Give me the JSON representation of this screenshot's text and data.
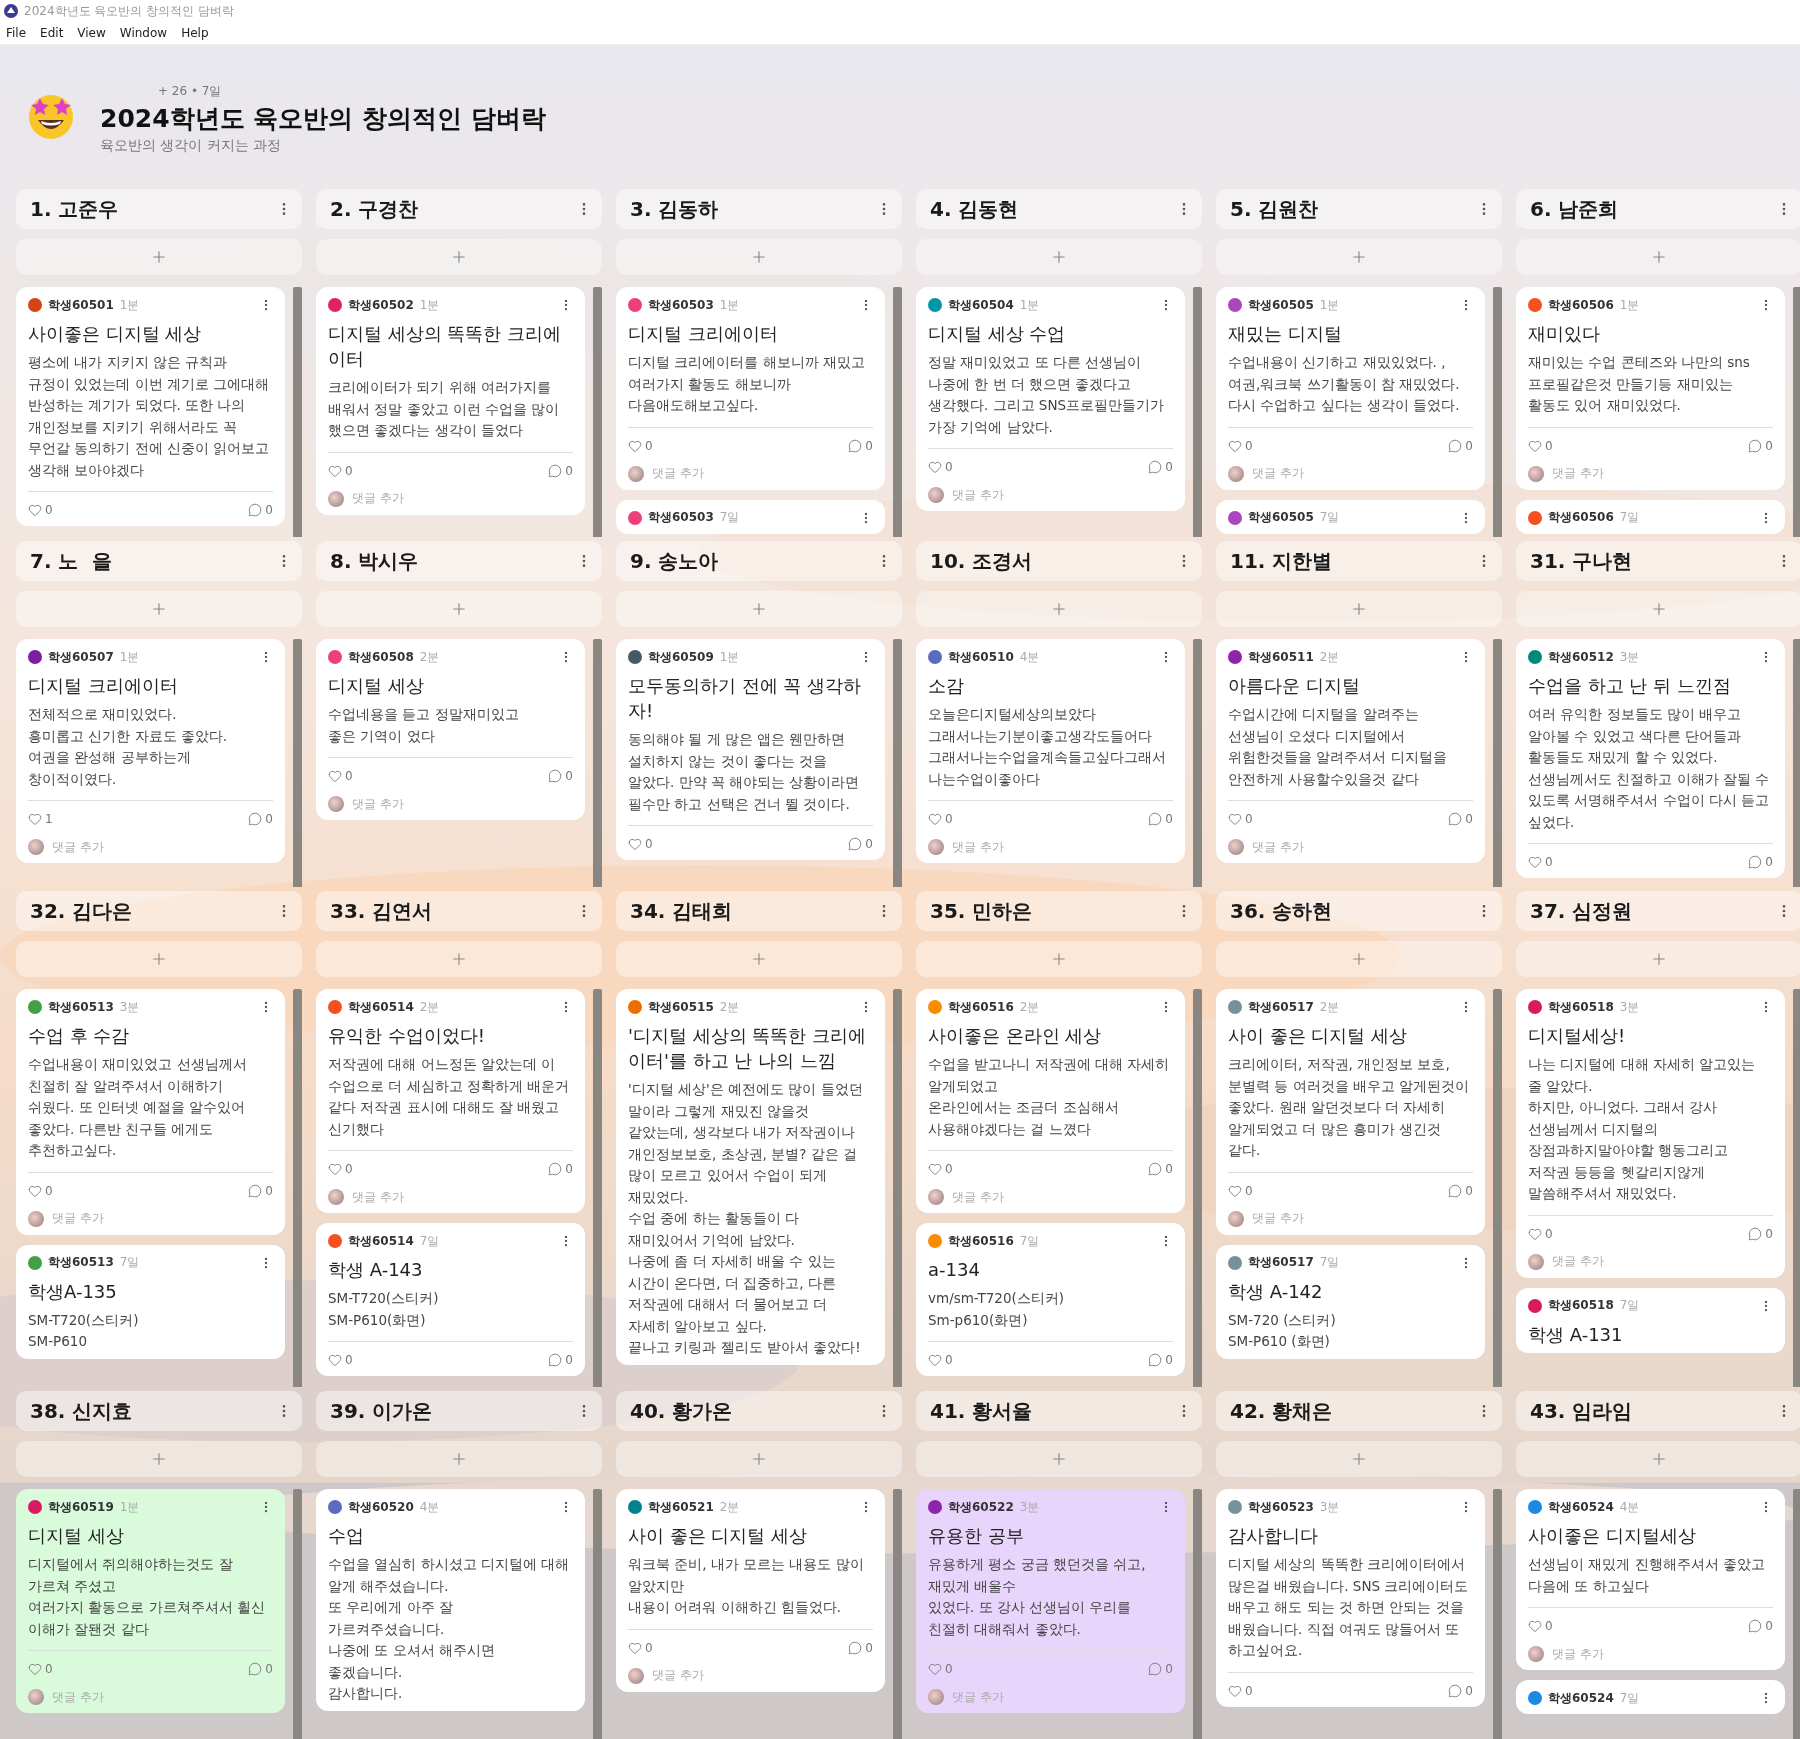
{
  "window": {
    "title": "2024학년도 육오반의 창의적인 담벼락"
  },
  "menu": [
    "File",
    "Edit",
    "View",
    "Window",
    "Help"
  ],
  "board": {
    "stats": "+ 26 • 7일",
    "title": "2024학년도 육오반의 창의적인 담벼락",
    "subtitle": "육오반의 생각이 커지는 과정"
  },
  "sections": [
    {
      "columns": [
        {
          "name": "1. 고준우",
          "posts": [
            {
              "author": "학생60501",
              "time": "1분",
              "color": "#d84315",
              "title": "사이좋은 디지털 세상",
              "body": "평소에 내가 지키지 않은 규칙과 규정이 있었는데 이번 계기로 그에대해 반성하는 계기가 되었다. 또한 나의 개인정보를 지키기 위해서라도 꼭 무언갈 동의하기 전에 신중이 읽어보고 생각해 보아야겠다",
              "likes": "0",
              "comments": "0"
            }
          ]
        },
        {
          "name": "2. 구경찬",
          "posts": [
            {
              "author": "학생60502",
              "time": "1분",
              "color": "#e0245e",
              "title": "디지털 세상의 똑똑한 크리에이터",
              "body": "크리에이터가 되기 위해 여러가지를 배워서 정말 좋았고 이런 수업을 많이 했으면 좋겠다는 생각이 들었다",
              "likes": "0",
              "comments": "0",
              "comment_placeholder": "댓글 추가"
            }
          ]
        },
        {
          "name": "3. 김동하",
          "posts": [
            {
              "author": "학생60503",
              "time": "1분",
              "color": "#ec407a",
              "title": "디지털 크리에이터",
              "body": "디지털 크리에이터를 해보니까 재밌고 여러가지 활동도 해보니까\n다음애도해보고싶다.",
              "likes": "0",
              "comments": "0",
              "comment_placeholder": "댓글 추가"
            },
            {
              "author": "학생60503",
              "time": "7일",
              "color": "#ec407a"
            }
          ]
        },
        {
          "name": "4. 김동현",
          "posts": [
            {
              "author": "학생60504",
              "time": "1분",
              "color": "#0097a7",
              "title": "디지털 세상 수업",
              "body": "정말 재미있었고 또 다른 선생님이 나중에 한 번 더 했으면 좋겠다고 생각했다. 그리고 SNS프로필만들기가 가장 기억에 남았다.",
              "likes": "0",
              "comments": "0",
              "comment_placeholder": "댓글 추가"
            }
          ]
        },
        {
          "name": "5. 김원찬",
          "posts": [
            {
              "author": "학생60505",
              "time": "1분",
              "color": "#ab47bc",
              "title": "재밌는 디지털",
              "body": "수업내용이 신기하고 재밌있었다. , 여권,워크북 쓰기활동이 참 재밌었다. 다시 수업하고 싶다는 생각이 들었다.",
              "likes": "0",
              "comments": "0",
              "comment_placeholder": "댓글 추가"
            },
            {
              "author": "학생60505",
              "time": "7일",
              "color": "#ab47bc"
            }
          ]
        },
        {
          "name": "6. 남준희",
          "posts": [
            {
              "author": "학생60506",
              "time": "1분",
              "color": "#f4511e",
              "title": "재미있다",
              "body": "재미있는 수업 콘테즈와 나만의 sns 프로필같은것 만들기등 재미있는 활동도 있어 재미있었다.",
              "likes": "0",
              "comments": "0",
              "comment_placeholder": "댓글 추가"
            },
            {
              "author": "학생60506",
              "time": "7일",
              "color": "#f4511e"
            }
          ]
        }
      ]
    },
    {
      "columns": [
        {
          "name": "7. 노  을",
          "posts": [
            {
              "author": "학생60507",
              "time": "1분",
              "color": "#7b1fa2",
              "title": "디지털 크리에이터",
              "body": "전체적으로 재미있었다.\n흥미롭고 신기한 자료도 좋았다.\n여권을 완성해 공부하는게 창이적이였다.",
              "likes": "1",
              "comments": "0",
              "comment_placeholder": "댓글 추가"
            }
          ]
        },
        {
          "name": "8. 박시우",
          "posts": [
            {
              "author": "학생60508",
              "time": "2분",
              "color": "#ec407a",
              "title": "디지털 세상",
              "body": "수업네용을 듣고 정말재미있고\n좋은 기역이 었다",
              "likes": "0",
              "comments": "0",
              "comment_placeholder": "댓글 추가"
            }
          ]
        },
        {
          "name": "9. 송노아",
          "posts": [
            {
              "author": "학생60509",
              "time": "1분",
              "color": "#455a64",
              "title": "모두동의하기 전에 꼭 생각하자!",
              "body": "동의해야 될 게 많은 앱은 웬만하면 설치하지 않는 것이 좋다는 것을 알았다. 만약 꼭 해야되는 상황이라면 필수만 하고 선택은 건너 뛸 것이다.",
              "likes": "0",
              "comments": "0"
            }
          ]
        },
        {
          "name": "10. 조경서",
          "posts": [
            {
              "author": "학생60510",
              "time": "4분",
              "color": "#5c6bc0",
              "title": "소감",
              "body": "오늘은디지털세상의보았다 그래서나는기분이좋고생각도들어다\n그래서나는수업을계속들고싶다그래서나는수업이좋아다",
              "likes": "0",
              "comments": "0",
              "comment_placeholder": "댓글 추가"
            }
          ]
        },
        {
          "name": "11. 지한별",
          "posts": [
            {
              "author": "학생60511",
              "time": "2분",
              "color": "#8e24aa",
              "title": "아름다운 디지털",
              "body": "수업시간에 디지털을 알려주는 선생님이 오셨다 디지털에서 위험한것들을 알려주셔서 디지털을 안전하게 사용할수있을것 같다",
              "likes": "0",
              "comments": "0",
              "comment_placeholder": "댓글 추가"
            }
          ]
        },
        {
          "name": "31. 구나현",
          "posts": [
            {
              "author": "학생60512",
              "time": "3분",
              "color": "#00897b",
              "title": "수업을 하고 난 뒤 느낀점",
              "body": "여러 유익한 정보들도 많이 배우고 알아볼 수 있었고 색다른 단어들과 활동들도 재밌게 할 수 있었다. 선생님께서도 친절하고 이해가 잘될 수 있도록 서명해주셔서 수업이 다시 듣고 싶었다.",
              "likes": "0",
              "comments": "0"
            }
          ]
        }
      ]
    },
    {
      "columns": [
        {
          "name": "32. 김다은",
          "posts": [
            {
              "author": "학생60513",
              "time": "3분",
              "color": "#43a047",
              "title": "수업 후 수감",
              "body": "수업내용이 재미있었고 선생님께서 친절히 잘 알려주셔서 이해하기 쉬웠다. 또  인터넷 예절을 알수있어 좋았다. 다른반 친구들 에게도 추천하고싶다.",
              "likes": "0",
              "comments": "0",
              "comment_placeholder": "댓글 추가"
            },
            {
              "author": "학생60513",
              "time": "7일",
              "color": "#43a047",
              "title": "학생A-135",
              "body": "SM-T720(스티커)\nSM-P610"
            }
          ]
        },
        {
          "name": "33. 김연서",
          "posts": [
            {
              "author": "학생60514",
              "time": "2분",
              "color": "#f4511e",
              "title": "유익한 수업이었다!",
              "body": "저작권에 대해 어느정돈 알았는데 이 수업으로 더 세심하고 정확하게 배운거 같다 저작권 표시에 대해도 잘 배웠고 신기했다",
              "likes": "0",
              "comments": "0",
              "comment_placeholder": "댓글 추가"
            },
            {
              "author": "학생60514",
              "time": "7일",
              "color": "#f4511e",
              "title": "학생 A-143",
              "body": "SM-T720(스티커)\nSM-P610(화면)",
              "likes": "0",
              "comments": "0"
            }
          ]
        },
        {
          "name": "34. 김태희",
          "posts": [
            {
              "author": "학생60515",
              "time": "2분",
              "color": "#ef6c00",
              "title": "'디지털 세상의 똑똑한 크리에이터'를 하고 난 나의 느낌",
              "body": "'디지털 세상'은 예전에도 많이 들었던 말이라 그렇게 재밌진 않을것 같았는데, 생각보다 내가 저작권이나 개인정보보호, 초상권, 분별? 같은 걸 많이 모르고 있어서 수업이 되게 재밌었다.\n수업 중에 하는 활동들이 다 재미있어서 기억에 남았다.\n나중에 좀 더 자세히 배울 수 있는 시간이 온다면, 더 집중하고, 다른 저작권에 대해서 더 물어보고 더 자세히 알아보고 싶다.\n끝나고 키링과 젤리도 받아서 좋았다!"
            }
          ]
        },
        {
          "name": "35. 민하은",
          "posts": [
            {
              "author": "학생60516",
              "time": "2분",
              "color": "#fb8c00",
              "title": "사이좋은 온라인 세상",
              "body": "수업을 받고나니 저작권에 대해 자세히 알게되었고\n온라인에서는 조금더 조심해서 사용해야겠다는 걸 느꼈다",
              "likes": "0",
              "comments": "0",
              "comment_placeholder": "댓글 추가"
            },
            {
              "author": "학생60516",
              "time": "7일",
              "color": "#fb8c00",
              "title": "a-134",
              "body": "vm/sm-T720(스티커)\nSm-p610(화면)",
              "likes": "0",
              "comments": "0"
            }
          ]
        },
        {
          "name": "36. 송하현",
          "posts": [
            {
              "author": "학생60517",
              "time": "2분",
              "color": "#78909c",
              "title": "사이 좋은 디지털 세상",
              "body": "크리에이터, 저작권, 개인정보 보호, 분별력 등 여러것을 배우고 알게된것이 좋았다. 원래 알던것보다 더 자세히 알게되었고 더 많은 흥미가 생긴것 같다.",
              "likes": "0",
              "comments": "0",
              "comment_placeholder": "댓글 추가"
            },
            {
              "author": "학생60517",
              "time": "7일",
              "color": "#78909c",
              "title": "학생 A-142",
              "body": "SM-720 (스티커)\nSM-P610 (화면)"
            }
          ]
        },
        {
          "name": "37. 심정원",
          "posts": [
            {
              "author": "학생60518",
              "time": "3분",
              "color": "#d81b60",
              "title": "디지털세상!",
              "body": "나는 디지털에 대해 자세히 알고있는 줄 알았다.\n하지만, 아니었다.  그래서 강사 선생님께서 디지털의\n장점과하지말아야할 행동그리고 저작권 등등을 헷갈리지않게\n말씀해주셔서 재밌었다.",
              "likes": "0",
              "comments": "0",
              "comment_placeholder": "댓글 추가"
            },
            {
              "author": "학생60518",
              "time": "7일",
              "color": "#d81b60",
              "title": "학생 A-131"
            }
          ]
        }
      ]
    },
    {
      "columns": [
        {
          "name": "38. 신지효",
          "posts": [
            {
              "author": "학생60519",
              "time": "1분",
              "color": "#d81b60",
              "card": {
                "color": "#d9fbdc"
              },
              "title": "디지털 세상",
              "body": "디지털에서 쥐의해야하는것도 잘 가르쳐 주셨고\n여러가지 활동으로 가르쳐주셔서 휠신 이해가 잘됀것 같다",
              "likes": "0",
              "comments": "0",
              "comment_placeholder": "댓글 추가"
            }
          ]
        },
        {
          "name": "39. 이가온",
          "posts": [
            {
              "author": "학생60520",
              "time": "4분",
              "color": "#5c6bc0",
              "title": "수업",
              "body": "수업을 열심히 하시셨고 디지털에 대해 알게 해주셨습니다.\n 또 우리에게 아주 잘 가르켜주셨습니다.\n나중에 또 오셔서 해주시면 좋겠습니다.\n감사합니다."
            }
          ]
        },
        {
          "name": "40. 황가온",
          "posts": [
            {
              "author": "학생60521",
              "time": "2분",
              "color": "#00838f",
              "title": "사이 좋은 디지털 세상",
              "body": "워크북 준비, 내가 모르는 내용도 많이 알았지만\n내용이 어려워 이해하긴 힘들었다.",
              "likes": "0",
              "comments": "0",
              "comment_placeholder": "댓글 추가"
            }
          ]
        },
        {
          "name": "41. 황서율",
          "posts": [
            {
              "author": "학생60522",
              "time": "3분",
              "color": "#8e24aa",
              "card": {
                "color": "#e8d5fb"
              },
              "title": "유용한 공부",
              "body": "유용하게 평소 궁금 했던것을 쉬고, 재밌게 배울수\n있었다.  또 강사 선생님이 우리를 친절히 대해줘서 좋았다.",
              "likes": "0",
              "comments": "0",
              "comment_placeholder": "댓글 추가"
            }
          ]
        },
        {
          "name": "42. 황채은",
          "posts": [
            {
              "author": "학생60523",
              "time": "3분",
              "color": "#78909c",
              "title": "감사합니다",
              "body": "디지털 세상의 똑똑한 크리에이터에서 많은걸 배웠습니다. SNS 크리에이터도 배우고 해도 되는 것 하면 안되는 것을 배웠습니다. 직접 여궈도 많들어서 또 하고싶어요.",
              "likes": "0",
              "comments": "0"
            }
          ]
        },
        {
          "name": "43. 임라임",
          "posts": [
            {
              "author": "학생60524",
              "time": "4분",
              "color": "#1e88e5",
              "title": "사이좋은 디지털세상",
              "body": "선생님이 재밌게 진행해주셔서 좋았고 다음에 또 하고싶다",
              "likes": "0",
              "comments": "0",
              "comment_placeholder": "댓글 추가"
            },
            {
              "author": "학생60524",
              "time": "7일",
              "color": "#1e88e5"
            }
          ]
        }
      ]
    }
  ]
}
